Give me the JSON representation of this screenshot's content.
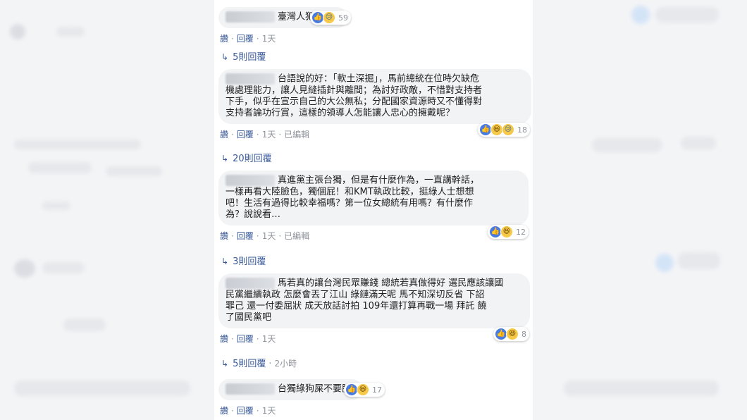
{
  "colors": {
    "link": "#385898",
    "bubble": "#f2f3f5",
    "like": "#4a7be0",
    "emoji": "#f7c948"
  },
  "comments": [
    {
      "text": "臺灣人犯賤",
      "reactions": [
        "like-icon",
        "sad-icon"
      ],
      "count": "59",
      "actions": {
        "like": "讚",
        "reply": "回覆",
        "time": "1天",
        "edited": ""
      },
      "replies": "5則回覆",
      "replies_time": ""
    },
    {
      "lines": [
        "台語說的好：「軟土深掘」，馬前總統在位時欠缺危",
        "機處理能力，讓人見縫插針與離間；為討好政敵，不惜對支持者",
        "下手，似乎在宣示自己的大公無私；分配國家資源時又不懂得對",
        "支持者論功行賞，這樣的領導人怎能讓人忠心的擁戴呢？"
      ],
      "reactions": [
        "like-icon",
        "haha-icon",
        "sad-icon"
      ],
      "count": "18",
      "actions": {
        "like": "讚",
        "reply": "回覆",
        "time": "1天",
        "edited": "已編輯"
      },
      "replies": "20則回覆",
      "replies_time": ""
    },
    {
      "lines": [
        "真進黨主張台獨，但是有什麼作為，一直講幹話，",
        "一樣再看大陸臉色，獨個屁！和KMT執政比較，挺綠人士想想",
        "吧！生活有過得比較幸福嗎？第一位女總統有用嗎？有什麼作",
        "為？說說看…"
      ],
      "reactions": [
        "like-icon",
        "haha-icon"
      ],
      "count": "12",
      "actions": {
        "like": "讚",
        "reply": "回覆",
        "time": "1天",
        "edited": "已編輯"
      },
      "replies": "3則回覆",
      "replies_time": ""
    },
    {
      "lines": [
        "馬若真的讓台灣民眾賺錢 總統若真做得好 選民應該讓國",
        "民黨繼續執政 怎麼會丟了江山 綠鏈滿天呢 馬不知深切反省 下詔",
        "罪己 還一付委屈狀 成天放話討拍 109年還打算再戰一場 拜託 饒",
        "了國民黨吧"
      ],
      "reactions": [
        "like-icon",
        "haha-icon"
      ],
      "count": "8",
      "actions": {
        "like": "讚",
        "reply": "回覆",
        "time": "1天",
        "edited": ""
      },
      "replies": "5則回覆",
      "replies_time": "2小時"
    },
    {
      "text": "台獨綠狗屎不要臉",
      "reactions": [
        "like-icon",
        "haha-icon"
      ],
      "count": "17",
      "actions": {
        "like": "讚",
        "reply": "回覆",
        "time": "1天",
        "edited": ""
      }
    }
  ]
}
